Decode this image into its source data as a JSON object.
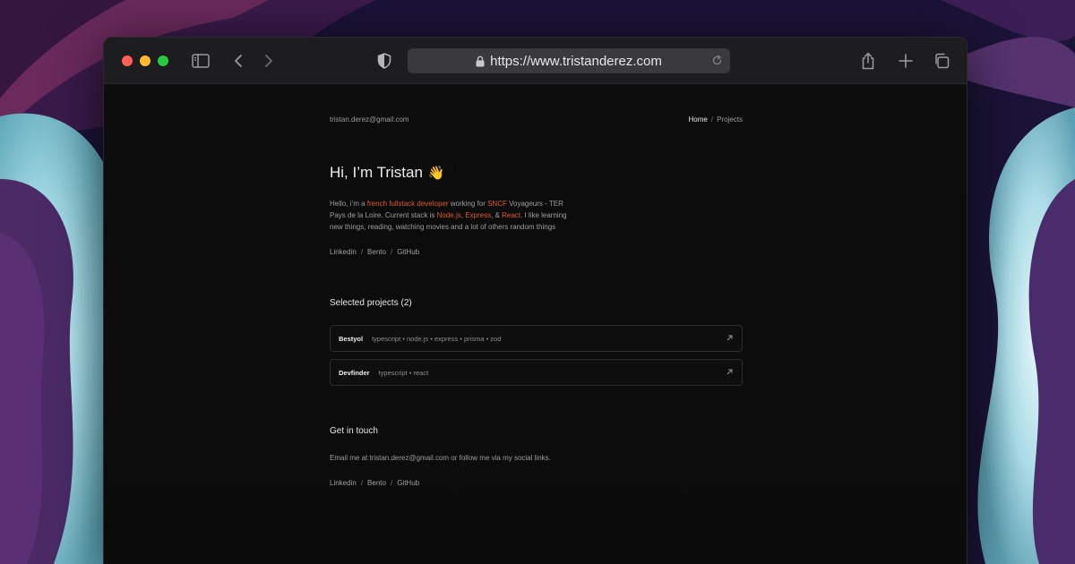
{
  "browser": {
    "url": "https://www.tristanderez.com"
  },
  "header": {
    "email": "tristan.derez@gmail.com",
    "nav": {
      "home": "Home",
      "separator": "/",
      "projects": "Projects"
    }
  },
  "hero": {
    "title": "Hi, I’m Tristan",
    "emoji": "👋",
    "intro": {
      "p1": "Hello, i’m a ",
      "h1": "french fullstack developer",
      "p2": " working for ",
      "h2": "SNCF",
      "p3": " Voyageurs - TER Pays de la Loire. Current stack is ",
      "h3": "Node.js",
      "p4": ", ",
      "h4": "Express",
      "p5": ", & ",
      "h5": "React",
      "p6": ". I like learning new things, reading, watching movies and a lot of others random things"
    }
  },
  "social_links": {
    "linkedin": "Linkedin",
    "bento": "Bento",
    "github": "GitHub",
    "separator": "/"
  },
  "projects": {
    "heading": "Selected projects (2)",
    "items": [
      {
        "name": "Bestyol",
        "stack": "typescript • node.js • express • prisma • zod"
      },
      {
        "name": "Devfinder",
        "stack": "typescript • react"
      }
    ]
  },
  "contact": {
    "heading": "Get in touch",
    "text": "Email me at tristan.derez@gmail.com or follow me via my social links."
  },
  "colors": {
    "accent": "#e2572e",
    "page_background": "#0c0c0c"
  }
}
